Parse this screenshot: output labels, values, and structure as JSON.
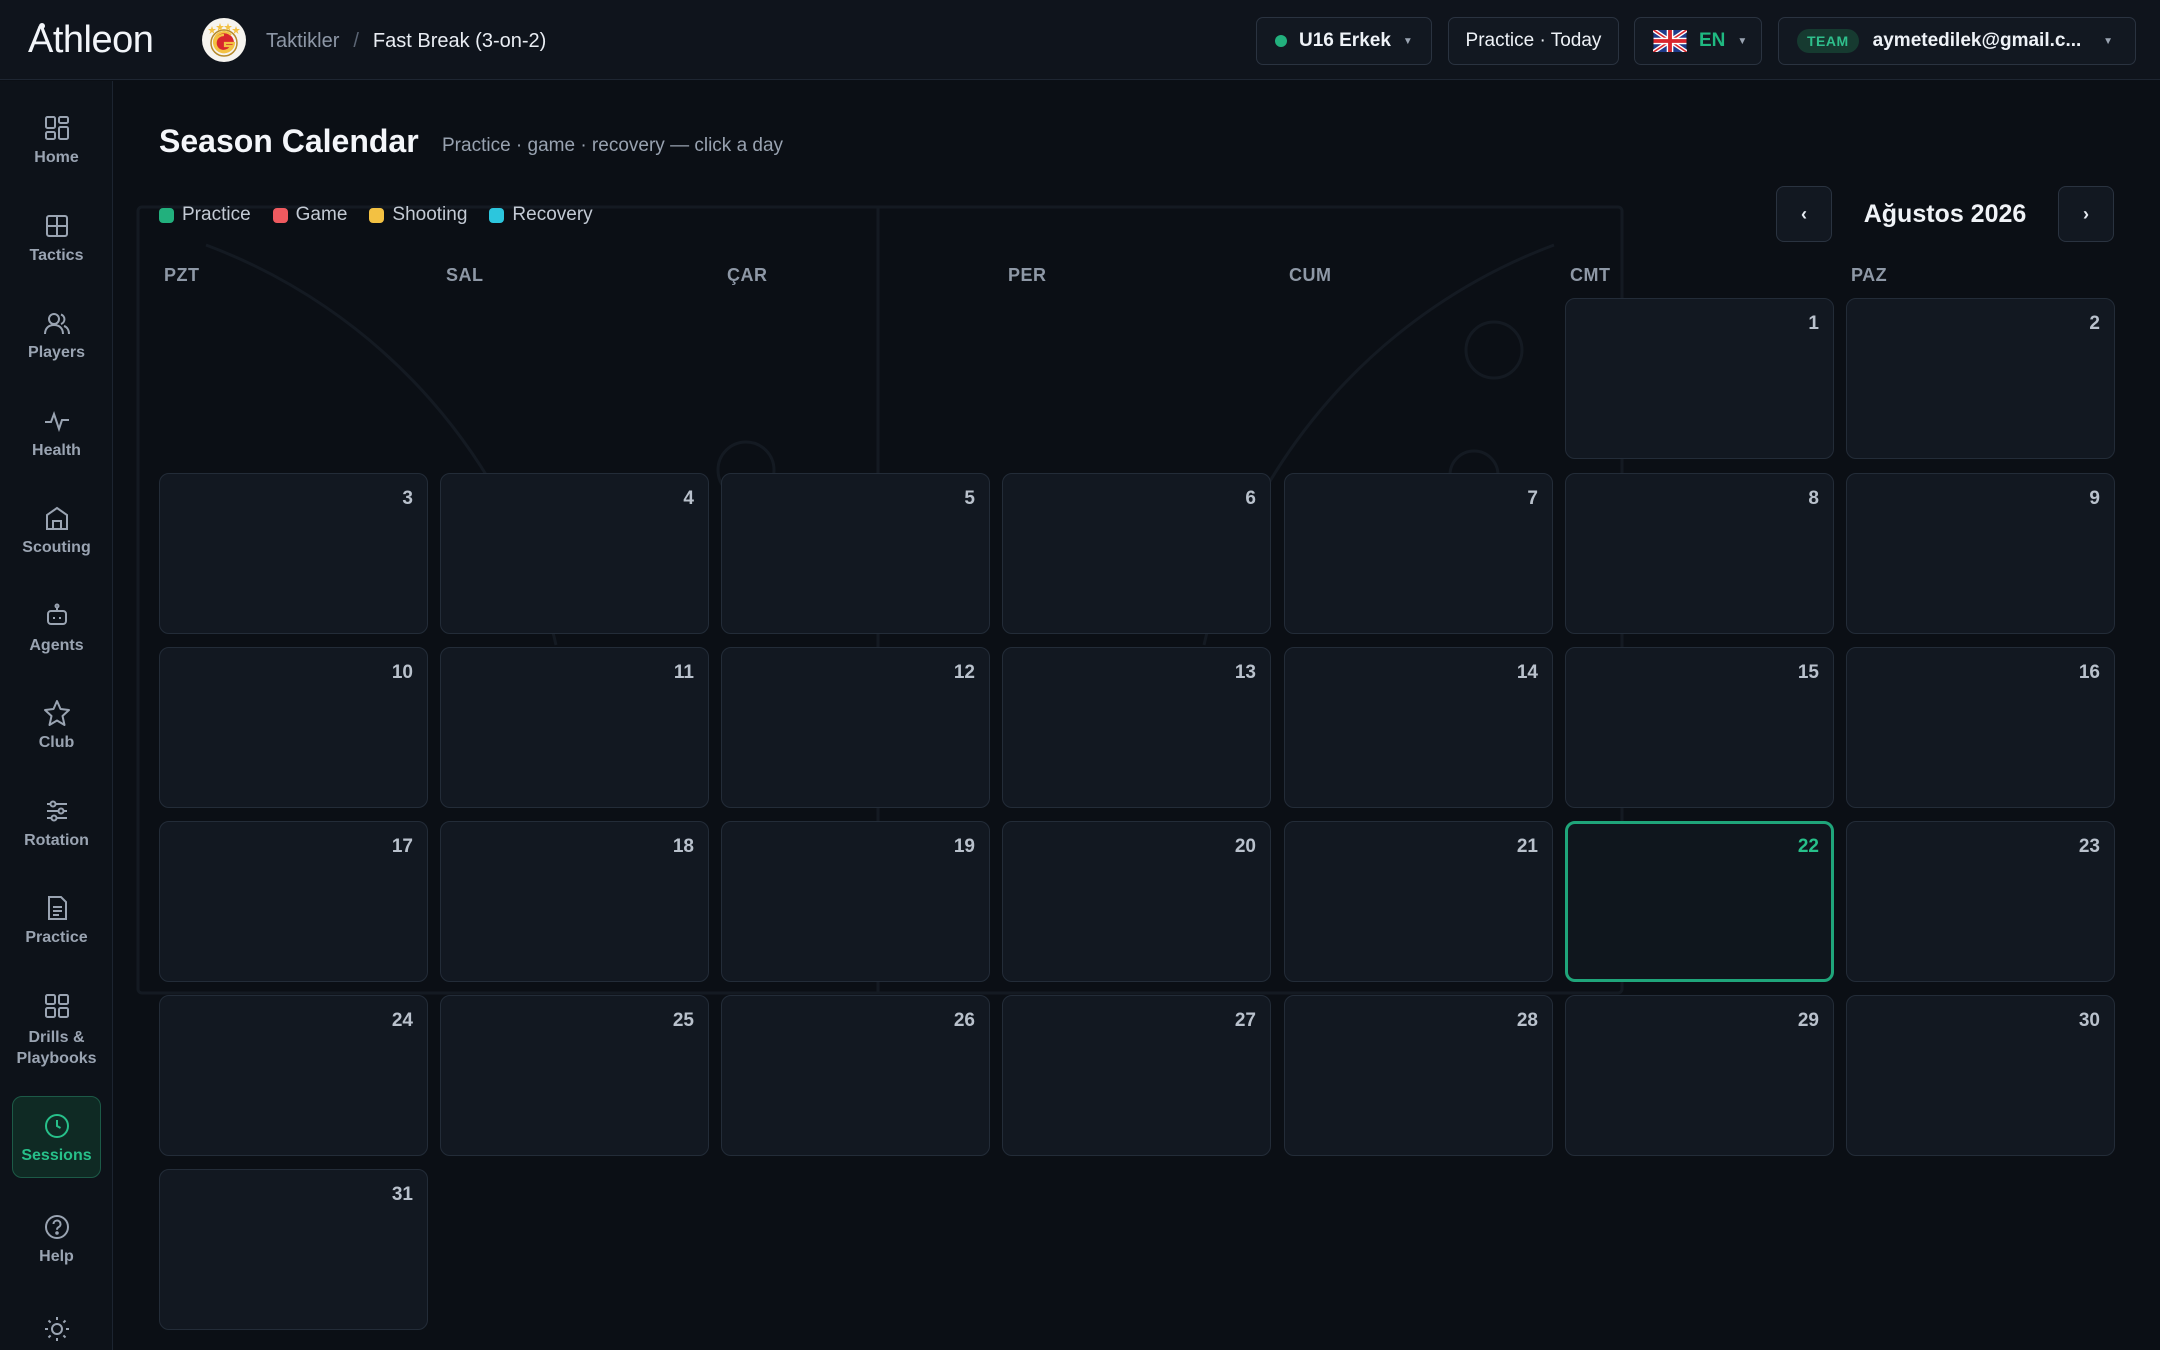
{
  "app": {
    "logo_text": "Athleon",
    "breadcrumb": {
      "parent": "Taktikler",
      "separator": "/",
      "current": "Fast Break (3-on-2)"
    }
  },
  "header": {
    "team_selector": "U16 Erkek",
    "practice_button": "Practice · Today",
    "language": "EN",
    "user_tag": "TEAM",
    "user_email": "aymetedilek@gmail.c..."
  },
  "sidebar": {
    "items": [
      {
        "label": "Home",
        "icon": "home-icon"
      },
      {
        "label": "Tactics",
        "icon": "tactics-icon"
      },
      {
        "label": "Players",
        "icon": "players-icon"
      },
      {
        "label": "Health",
        "icon": "health-icon"
      },
      {
        "label": "Scouting",
        "icon": "scouting-icon"
      },
      {
        "label": "Agents",
        "icon": "agents-icon"
      },
      {
        "label": "Club",
        "icon": "star-icon"
      },
      {
        "label": "Rotation",
        "icon": "sliders-icon"
      },
      {
        "label": "Practice",
        "icon": "document-icon"
      },
      {
        "label": "Drills & Playbooks",
        "label_line1": "Drills &",
        "label_line2": "Playbooks",
        "icon": "grid-icon"
      },
      {
        "label": "Sessions",
        "icon": "clock-icon",
        "active": true
      },
      {
        "label": "Help",
        "icon": "help-icon"
      }
    ]
  },
  "calendar": {
    "title": "Season Calendar",
    "subtitle": "Practice · game · recovery — click a day",
    "legend": [
      {
        "label": "Practice",
        "color": "#22b07d"
      },
      {
        "label": "Game",
        "color": "#ef5a5f"
      },
      {
        "label": "Shooting",
        "color": "#f3c142"
      },
      {
        "label": "Recovery",
        "color": "#2cc6dd"
      }
    ],
    "month_label": "Ağustos 2026",
    "prev_label": "‹",
    "next_label": "›",
    "weekdays": [
      "PZT",
      "SAL",
      "ÇAR",
      "PER",
      "CUM",
      "CMT",
      "PAZ"
    ],
    "days": [
      "1",
      "2",
      "3",
      "4",
      "5",
      "6",
      "7",
      "8",
      "9",
      "10",
      "11",
      "12",
      "13",
      "14",
      "15",
      "16",
      "17",
      "18",
      "19",
      "20",
      "21",
      "22",
      "23",
      "24",
      "25",
      "26",
      "27",
      "28",
      "29",
      "30",
      "31"
    ],
    "today": "22"
  },
  "colors": {
    "accent": "#27c08a",
    "background": "#0b0f15",
    "cell": "#121821"
  }
}
